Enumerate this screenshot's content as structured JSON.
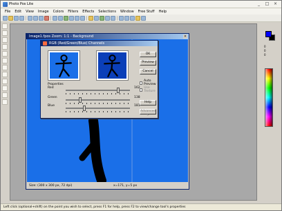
{
  "window": {
    "title": "Photo Pos Lite",
    "controls": [
      "_",
      "□",
      "×"
    ]
  },
  "menu": [
    "File",
    "Edit",
    "View",
    "Image",
    "Colors",
    "Filters",
    "Effects",
    "Selections",
    "Window",
    "Free Stuff",
    "Help"
  ],
  "image_window": {
    "title": "Image1.fpos  Zoom: 1:1 - Background",
    "status_left": "Size: (300 x 300 px, 72 dpi)",
    "status_right": "x=171, y=5 px"
  },
  "dialog": {
    "title": "RGB (Red/Green/Blue) Channels",
    "properties_label": "Properties",
    "buttons": {
      "ok": "OK",
      "preview": "Preview",
      "cancel": "Cancel",
      "help": "Help",
      "advanced": "Advanced >"
    },
    "checkboxes": {
      "auto_preview": "Auto Preview",
      "use_texture": "Use Texture"
    },
    "sliders": [
      {
        "label": "Red",
        "value": "162",
        "fraction": 0.82
      },
      {
        "label": "Green",
        "value": "138",
        "fraction": 0.23
      },
      {
        "label": "Blue",
        "value": "181",
        "fraction": 0.29
      }
    ],
    "preview_colors": {
      "before": "#1a6fe8",
      "after": "#0b3fb8"
    }
  },
  "colors": {
    "foreground": "#0000ff",
    "background": "#000000",
    "canvas": "#1a6fe8"
  },
  "right_panel": {
    "small_labels": [
      "0",
      "0",
      "0"
    ]
  },
  "statusbar": {
    "text": "Left click (optional+shift) on the point you wish to select, press F1 for help, press F2 to view/change tool's properties"
  }
}
